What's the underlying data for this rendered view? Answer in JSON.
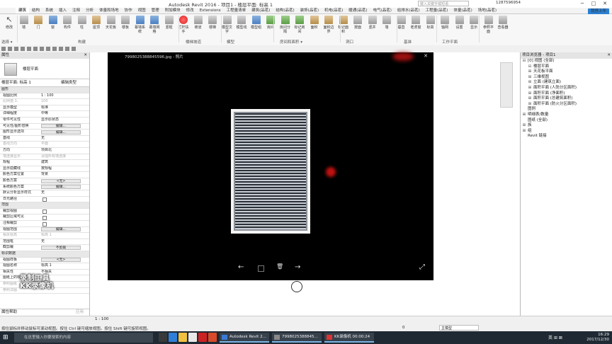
{
  "titlebar": {
    "title": "Autodesk Revit 2016 -  项目1 - 楼层平面: 标高 1",
    "search_placeholder": "键入关键字或短语",
    "user": "1287596954",
    "min": "─",
    "max": "□",
    "close": "✕"
  },
  "tabs": [
    "建筑",
    "结构",
    "系统",
    "插入",
    "注释",
    "分析",
    "体量和场地",
    "协作",
    "视图",
    "管理",
    "附加模块",
    "修改",
    "Extensions",
    "工程量清单",
    "建筑(品茗)",
    "结构(品茗)",
    "装饰(品茗)",
    "机电(品茗)",
    "暖通(品茗)",
    "电气(品茗)",
    "给排水(品茗)",
    "工程量(品茗)",
    "体量(品茗)",
    "场地(品茗)"
  ],
  "share_button": "我搭上年",
  "ribbon": {
    "buttons": [
      {
        "label": "修改",
        "icon": "arrow"
      },
      {
        "label": "墙",
        "icon": "grey"
      },
      {
        "label": "门",
        "icon": "brown"
      },
      {
        "label": "窗",
        "icon": "blue"
      },
      {
        "label": "构件",
        "icon": "grey"
      },
      {
        "label": "柱",
        "icon": "grey"
      },
      {
        "label": "屋顶",
        "icon": "brown"
      },
      {
        "label": "天花板",
        "icon": "grey"
      },
      {
        "label": "楼板",
        "icon": "grey"
      },
      {
        "label": "幕墙系统",
        "icon": "blue"
      },
      {
        "label": "幕墙网格",
        "icon": "blue"
      },
      {
        "label": "竖梃",
        "icon": "grey"
      },
      {
        "label": "栏杆扶手",
        "icon": "red"
      },
      {
        "label": "坡道",
        "icon": "grey"
      },
      {
        "label": "楼梯",
        "icon": "grey"
      },
      {
        "label": "模型文字",
        "icon": "grey"
      },
      {
        "label": "模型线",
        "icon": "grey"
      },
      {
        "label": "模型组",
        "icon": "blue"
      },
      {
        "label": "房间",
        "icon": "green"
      },
      {
        "label": "房间分隔",
        "icon": "green"
      },
      {
        "label": "标记房间",
        "icon": "green"
      },
      {
        "label": "面积",
        "icon": "brown"
      },
      {
        "label": "面积边界",
        "icon": "brown"
      },
      {
        "label": "标记面积",
        "icon": "brown"
      },
      {
        "label": "按面",
        "icon": "grey"
      },
      {
        "label": "竖井",
        "icon": "grey"
      },
      {
        "label": "墙",
        "icon": "grey"
      },
      {
        "label": "垂直",
        "icon": "grey"
      },
      {
        "label": "老虎窗",
        "icon": "grey"
      },
      {
        "label": "标高",
        "icon": "grey"
      },
      {
        "label": "轴网",
        "icon": "grey"
      },
      {
        "label": "设置",
        "icon": "grey"
      },
      {
        "label": "显示",
        "icon": "grey"
      },
      {
        "label": "参照平面",
        "icon": "grey"
      },
      {
        "label": "查看器",
        "icon": "grey"
      }
    ],
    "panels": [
      "选择 ▾",
      "构建",
      "楼梯坡道",
      "模型",
      "房间和面积 ▾",
      "洞口",
      "基准",
      "工作平面"
    ]
  },
  "options_bar": "选择 ▾",
  "properties": {
    "header": "属性",
    "type_name": "楼层平面",
    "view_selector": "楼层平面: 标高 1",
    "edit_type": "编辑类型",
    "rows": [
      {
        "k": "图形",
        "v": "",
        "kind": "grp"
      },
      {
        "k": "视图比例",
        "v": "1 : 100",
        "kind": "input"
      },
      {
        "k": "比例值 1:",
        "v": "100",
        "kind": "dis"
      },
      {
        "k": "显示模型",
        "v": "标准"
      },
      {
        "k": "详细程度",
        "v": "中等"
      },
      {
        "k": "零件可见性",
        "v": "显示原状态"
      },
      {
        "k": "可见性/图形替换",
        "v": "编辑...",
        "kind": "btn"
      },
      {
        "k": "图形显示选项",
        "v": "编辑...",
        "kind": "btn"
      },
      {
        "k": "基线",
        "v": "无"
      },
      {
        "k": "基线方向",
        "v": "平面",
        "kind": "dis"
      },
      {
        "k": "方向",
        "v": "项目北"
      },
      {
        "k": "墙连接显示",
        "v": "清理所有墙连接",
        "kind": "dis"
      },
      {
        "k": "规程",
        "v": "建筑"
      },
      {
        "k": "显示隐藏线",
        "v": "按规程"
      },
      {
        "k": "颜色方案位置",
        "v": "背景"
      },
      {
        "k": "颜色方案",
        "v": "<无>",
        "kind": "btn"
      },
      {
        "k": "系统颜色方案",
        "v": "编辑...",
        "kind": "btn"
      },
      {
        "k": "默认分析显示样式",
        "v": "无"
      },
      {
        "k": "日光路径",
        "v": "",
        "kind": "cb"
      },
      {
        "k": "范围",
        "v": "",
        "kind": "grp"
      },
      {
        "k": "裁剪视图",
        "v": "",
        "kind": "cb"
      },
      {
        "k": "裁剪区域可见",
        "v": "",
        "kind": "cb"
      },
      {
        "k": "注释裁剪",
        "v": "",
        "kind": "cb"
      },
      {
        "k": "视图范围",
        "v": "编辑...",
        "kind": "btn"
      },
      {
        "k": "相关标高",
        "v": "标高 1",
        "kind": "dis"
      },
      {
        "k": "范围框",
        "v": "无"
      },
      {
        "k": "截剪裁",
        "v": "不剪裁",
        "kind": "btn"
      },
      {
        "k": "标识数据",
        "v": "",
        "kind": "grp"
      },
      {
        "k": "视图样板",
        "v": "<无>",
        "kind": "btn"
      },
      {
        "k": "视图名称",
        "v": "标高 1"
      },
      {
        "k": "相关性",
        "v": "不相关"
      },
      {
        "k": "图纸上的标题",
        "v": ""
      },
      {
        "k": "参照图纸",
        "v": "",
        "kind": "dis"
      },
      {
        "k": "参照详图",
        "v": "",
        "kind": "dis"
      }
    ],
    "help": "属性帮助",
    "apply": "应用"
  },
  "watermark": [
    "录制工具",
    "KK录像机"
  ],
  "viewer": {
    "filename": "7998025388845596.jpg - 照片",
    "close": "✕",
    "prev": "←",
    "next": "→",
    "delete": "🗑",
    "fullscreen": "⤢"
  },
  "browser": {
    "header": "项目浏览器 - 项目1",
    "close": "✕",
    "items": [
      {
        "indent": 0,
        "exp": "⊟",
        "label": "[0] 视图 (全部)"
      },
      {
        "indent": 1,
        "exp": "⊟",
        "label": "楼层平面"
      },
      {
        "indent": 1,
        "exp": "⊞",
        "label": "天花板平面"
      },
      {
        "indent": 1,
        "exp": "⊞",
        "label": "三维视图"
      },
      {
        "indent": 1,
        "exp": "⊞",
        "label": "立面 (建筑立面)"
      },
      {
        "indent": 1,
        "exp": "⊞",
        "label": "面积平面 (人防分区面积)"
      },
      {
        "indent": 1,
        "exp": "⊞",
        "label": "面积平面 (净面积)"
      },
      {
        "indent": 1,
        "exp": "⊞",
        "label": "面积平面 (总建筑面积)"
      },
      {
        "indent": 1,
        "exp": "⊞",
        "label": "面积平面 (防火分区面积)"
      },
      {
        "indent": 0,
        "exp": "",
        "label": "图例"
      },
      {
        "indent": 0,
        "exp": "⊞",
        "label": "明细表/数量"
      },
      {
        "indent": 0,
        "exp": "",
        "label": "图纸 (全部)"
      },
      {
        "indent": 0,
        "exp": "⊞",
        "label": "族"
      },
      {
        "indent": 0,
        "exp": "⊞",
        "label": "组"
      },
      {
        "indent": 0,
        "exp": "",
        "label": "Revit 链接"
      }
    ]
  },
  "statusbar": {
    "scale": "1 : 100",
    "message": "按住鼠标并移动鼠标可滚动视图。按住 Ctrl 键可缩放视图。按住 Shift 键可旋转视图。",
    "zero": "0",
    "main_model": "主模型"
  },
  "taskbar": {
    "search_placeholder": "在这里输入你要搜索的内容",
    "tasks": [
      "Autodesk Revit 2...",
      "7998025388845...",
      "KK录像机 00:00:24"
    ],
    "time": "16:29",
    "date": "2017/12/30",
    "tray": "英 ⊞ ⊠"
  }
}
